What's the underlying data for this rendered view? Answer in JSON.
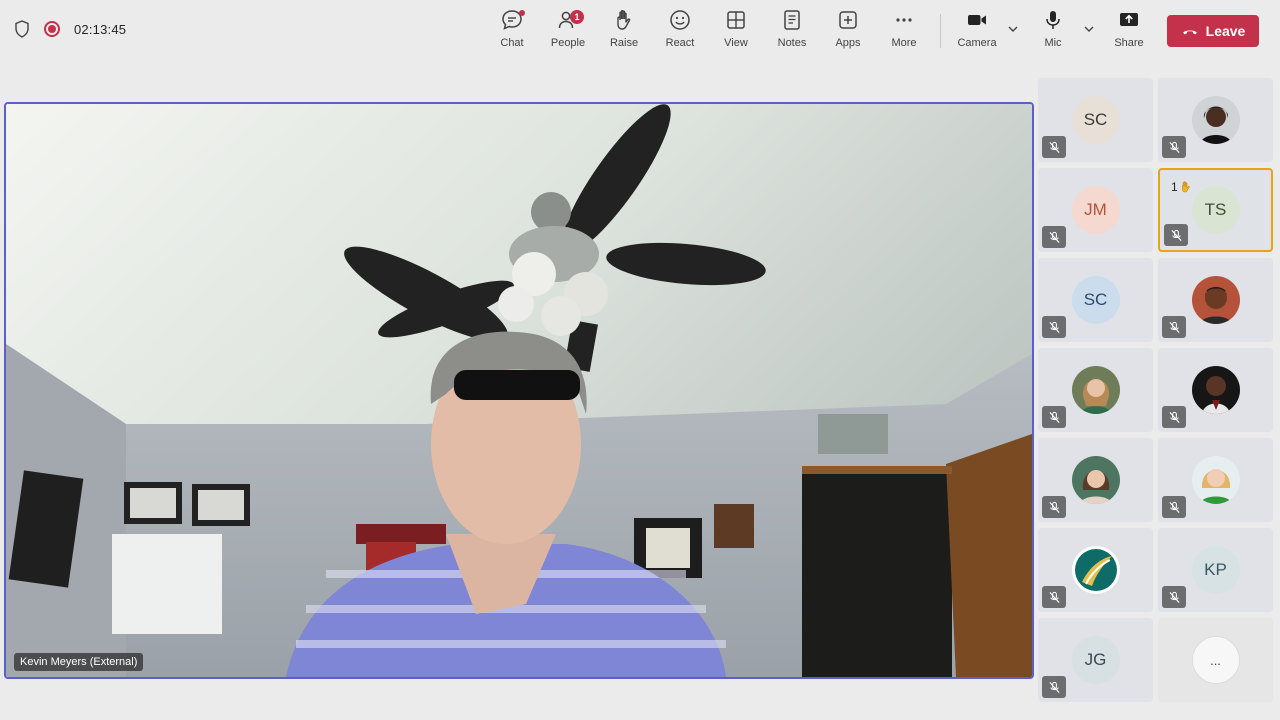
{
  "meeting": {
    "timer": "02:13:45"
  },
  "toolbar": {
    "chat": "Chat",
    "people": "People",
    "people_badge": "1",
    "raise": "Raise",
    "react": "React",
    "view": "View",
    "notes": "Notes",
    "apps": "Apps",
    "more": "More",
    "camera": "Camera",
    "mic": "Mic",
    "share": "Share",
    "leave": "Leave"
  },
  "stage": {
    "speaker_name": "Kevin Meyers (External)"
  },
  "participants": [
    {
      "initials": "SC",
      "avatar_color": "#e8e0d6",
      "photo": false
    },
    {
      "initials": "",
      "avatar_color": "#d8d8d8",
      "photo": true,
      "photo_icon": "person-photo-dark-hair"
    },
    {
      "initials": "JM",
      "avatar_color": "#f5d8cf",
      "photo": false
    },
    {
      "initials": "TS",
      "avatar_color": "#d9e4d3",
      "photo": false,
      "hand_raised": true,
      "hand_count": "1"
    },
    {
      "initials": "SC",
      "avatar_color": "#cbdcec",
      "photo": false
    },
    {
      "initials": "",
      "avatar_color": "#9b5c3e",
      "photo": true,
      "photo_icon": "person-photo-child"
    },
    {
      "initials": "",
      "avatar_color": "#7d8a64",
      "photo": true,
      "photo_icon": "person-photo-blonde"
    },
    {
      "initials": "",
      "avatar_color": "#3d2a22",
      "photo": true,
      "photo_icon": "person-photo-man"
    },
    {
      "initials": "",
      "avatar_color": "#5d7e6a",
      "photo": true,
      "photo_icon": "person-photo-brunette"
    },
    {
      "initials": "",
      "avatar_color": "#7eb07a",
      "photo": true,
      "photo_icon": "person-photo-blonde-green"
    },
    {
      "initials": "",
      "avatar_color": "#0f6b68",
      "photo": true,
      "photo_icon": "logo-avatar"
    },
    {
      "initials": "KP",
      "avatar_color": "#d6e2e4",
      "photo": false
    },
    {
      "initials": "JG",
      "avatar_color": "#d7e0e3",
      "photo": false
    }
  ],
  "overflow": {
    "label": "..."
  }
}
